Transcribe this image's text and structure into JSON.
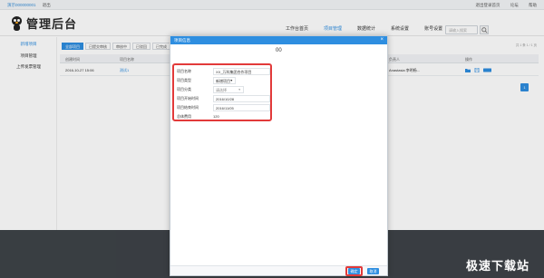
{
  "topbar": {
    "user": "演示000000001",
    "exit_label": "退出",
    "links": [
      "退出登录首页",
      "论坛",
      "帮助"
    ]
  },
  "header": {
    "logo_text": "管理后台",
    "nav": [
      {
        "label": "工作台首页",
        "active": false
      },
      {
        "label": "项目管理",
        "active": true
      },
      {
        "label": "数据统计",
        "active": false
      },
      {
        "label": "系统设置",
        "active": false
      },
      {
        "label": "账号设置",
        "active": false
      }
    ],
    "search_placeholder": "请输入搜索"
  },
  "sidebar": {
    "items": [
      {
        "label": "新增项目",
        "active": true
      },
      {
        "label": "项目管理",
        "active": false
      },
      {
        "label": "上传发票管理",
        "active": false
      }
    ]
  },
  "content": {
    "tabs": [
      {
        "label": "全部项目",
        "active": true
      },
      {
        "label": "已提交审核",
        "active": false
      },
      {
        "label": "审核中",
        "active": false
      },
      {
        "label": "已驳回",
        "active": false
      },
      {
        "label": "已完成",
        "active": false
      }
    ],
    "pager_info": "共 1 条 1 / 1 页",
    "columns": [
      "创建时间",
      "项目名称",
      "负责人",
      "操作"
    ],
    "rows": [
      {
        "date": "2016-10-27 15:06",
        "name": "测试1",
        "owner": "Anastasia 李明杨..."
      }
    ],
    "page": "1"
  },
  "modal": {
    "title": "项目信息",
    "header_mark": "00",
    "fields": [
      {
        "label": "项目名称",
        "value": "XX_万科集团合作项目",
        "kind": "text"
      },
      {
        "label": "项目类型",
        "value": "新增项目",
        "kind": "select"
      },
      {
        "label": "项目分类",
        "value": "请选择",
        "kind": "select-empty"
      },
      {
        "label": "项目开始时间",
        "value": "2016/10/28",
        "kind": "text"
      },
      {
        "label": "项目结束时间",
        "value": "2016/11/05",
        "kind": "text"
      },
      {
        "label": "总体费用",
        "value": "120",
        "kind": "plain"
      }
    ],
    "ok_label": "确定",
    "cancel_label": "取消"
  },
  "watermark": "极速下载站",
  "colors": {
    "accent": "#2e8ee0",
    "highlight": "#e23a3a",
    "footer": "#3e4348"
  }
}
